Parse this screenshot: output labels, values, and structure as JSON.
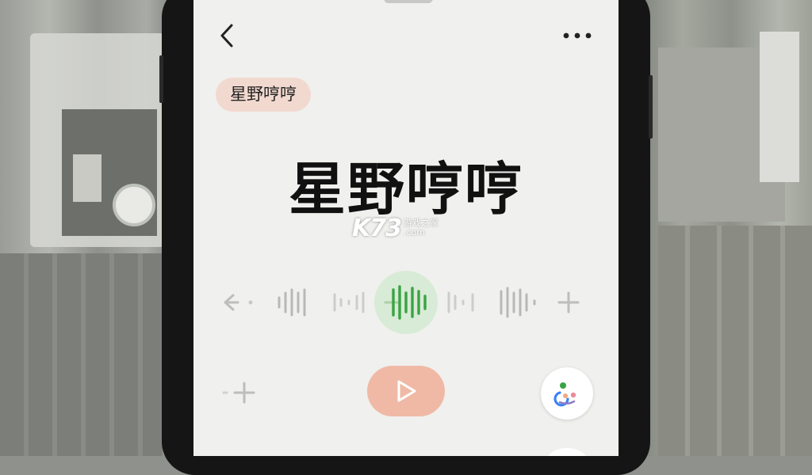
{
  "header": {
    "back_icon": "chevron-left-icon",
    "more_icon": "more-horizontal-icon"
  },
  "tag": {
    "label": "星野哼哼"
  },
  "title": {
    "text": "星野哼哼"
  },
  "watermark": {
    "logo": "K73",
    "line1": "游戏之家",
    "line2": ".com"
  },
  "wave_row": {
    "left_icon": "arrow-left-icon",
    "right_icon": "plus-icon",
    "items": [
      "voice-1",
      "voice-2",
      "voice-3-active",
      "voice-4",
      "voice-5"
    ]
  },
  "controls": {
    "play_icon": "play-icon",
    "add_icon": "plus-icon",
    "fab_icon": "people-icon"
  },
  "colors": {
    "tag_bg": "#f2d9cf",
    "active_wave": "#3aa344",
    "active_bg": "#d8ebd6",
    "play_bg": "#f0b9a6"
  }
}
